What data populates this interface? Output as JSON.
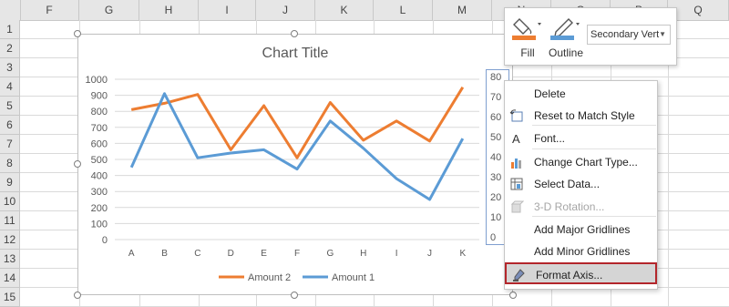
{
  "sheet": {
    "columns": [
      "F",
      "G",
      "H",
      "I",
      "J",
      "K",
      "L",
      "M",
      "N",
      "O",
      "P",
      "Q"
    ],
    "rows": [
      "1",
      "2",
      "3",
      "4",
      "5",
      "6",
      "7",
      "8",
      "9",
      "10",
      "11",
      "12",
      "13",
      "14",
      "15"
    ]
  },
  "chart": {
    "title": "Chart Title",
    "secondary_axis_ticks": [
      "80",
      "70",
      "60",
      "50",
      "40",
      "30",
      "20",
      "10",
      "0"
    ],
    "legend": [
      {
        "name": "Amount 2",
        "color": "#ED7D31"
      },
      {
        "name": "Amount 1",
        "color": "#5B9BD5"
      }
    ]
  },
  "chart_data": {
    "type": "line",
    "categories": [
      "A",
      "B",
      "C",
      "D",
      "E",
      "F",
      "G",
      "H",
      "I",
      "J",
      "K"
    ],
    "series": [
      {
        "name": "Amount 2",
        "color": "#ED7D31",
        "values": [
          810,
          850,
          905,
          560,
          835,
          510,
          855,
          620,
          740,
          615,
          950
        ]
      },
      {
        "name": "Amount 1",
        "color": "#5B9BD5",
        "values": [
          450,
          910,
          510,
          540,
          560,
          440,
          740,
          570,
          380,
          250,
          630
        ]
      }
    ],
    "title": "Chart Title",
    "ylim": [
      0,
      1000
    ],
    "yticks": [
      "1000",
      "900",
      "800",
      "700",
      "600",
      "500",
      "400",
      "300",
      "200",
      "100",
      "0"
    ],
    "grid": true,
    "legend_position": "bottom"
  },
  "toolbar": {
    "fill_label": "Fill",
    "outline_label": "Outline",
    "element_select": "Secondary Vert"
  },
  "menu": [
    {
      "label": "Delete",
      "icon": "",
      "disabled": false
    },
    {
      "label": "Reset to Match Style",
      "icon": "reset-style-icon",
      "disabled": false
    },
    {
      "label": "Font...",
      "icon": "font-icon",
      "disabled": false
    },
    {
      "label": "Change Chart Type...",
      "icon": "chart-type-icon",
      "disabled": false
    },
    {
      "label": "Select Data...",
      "icon": "select-data-icon",
      "disabled": false
    },
    {
      "label": "3-D Rotation...",
      "icon": "rotation-3d-icon",
      "disabled": true
    },
    {
      "label": "Add Major Gridlines",
      "icon": "",
      "disabled": false
    },
    {
      "label": "Add Minor Gridlines",
      "icon": "",
      "disabled": false
    },
    {
      "label": "Format Axis...",
      "icon": "format-axis-icon",
      "disabled": false,
      "highlighted": true
    }
  ]
}
